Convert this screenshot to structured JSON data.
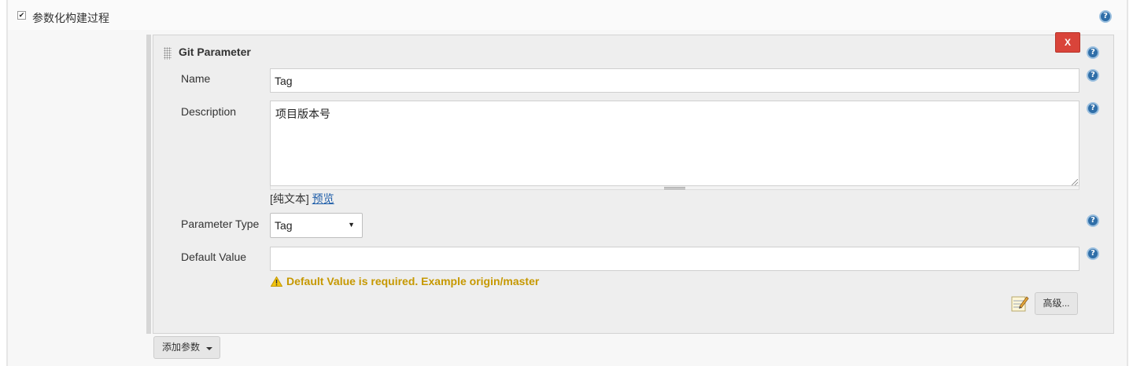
{
  "section": {
    "checkbox_mark": "✔",
    "label": "参数化构建过程",
    "help_glyph": "?"
  },
  "parameter_block": {
    "title": "Git Parameter",
    "delete_label": "X",
    "fields": {
      "name": {
        "label": "Name",
        "value": "Tag"
      },
      "description": {
        "label": "Description",
        "value": "项目版本号"
      },
      "markup": {
        "plain_text": "[纯文本]",
        "preview_link": "预览"
      },
      "parameter_type": {
        "label": "Parameter Type",
        "selected": "Tag"
      },
      "default_value": {
        "label": "Default Value",
        "value": "",
        "warning": "Default Value is required. Example origin/master"
      }
    },
    "advanced_label": "高级..."
  },
  "add_parameter_label": "添加参数",
  "colors": {
    "delete": "#d9443a",
    "help": "#2f6ea8",
    "warning": "#c69800",
    "link": "#1f5ea9"
  },
  "icons": {
    "help": "help-icon",
    "warning": "warning-icon",
    "notepad": "notepad-icon",
    "drag": "drag-handle-icon"
  }
}
